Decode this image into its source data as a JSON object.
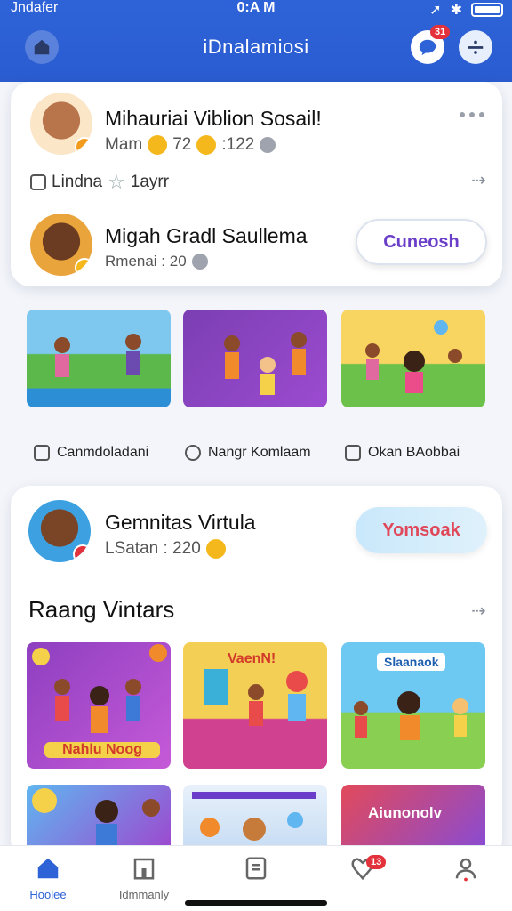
{
  "status": {
    "carrier": "Jndafer",
    "time": "0:A M"
  },
  "header": {
    "title": "iDnalamiosi",
    "chat_badge": "31"
  },
  "profile1": {
    "name": "Mihauriai Viblion Sosail!",
    "stats_label": "Mam",
    "stat1": "72",
    "stat2": ":122",
    "tag": "Lindna",
    "rating": "1ayrr"
  },
  "profile2": {
    "name": "Migah Gradl Saullema",
    "sub": "Rmenai : 20",
    "button": "Cuneosh"
  },
  "row1": [
    {
      "caption": "Canmdoladani"
    },
    {
      "caption": "Nangr Komlaam"
    },
    {
      "caption": "Okan BAobbai"
    }
  ],
  "profile3": {
    "name": "Gemnitas Virtula",
    "sub": "LSatan : 220",
    "button": "Yomsoak"
  },
  "section": {
    "title": "Raang Vintars"
  },
  "row2": [
    {
      "banner": "Nahlu Noog"
    },
    {
      "banner": "VaenN!"
    },
    {
      "banner": "Slaanaok"
    }
  ],
  "row3": [
    {
      "banner": ""
    },
    {
      "banner": ""
    },
    {
      "banner": "Aiunonolv"
    }
  ],
  "nav": [
    {
      "label": "Hoolee"
    },
    {
      "label": "Idmmanly"
    },
    {
      "label": ""
    },
    {
      "label": "",
      "badge": "13"
    },
    {
      "label": ""
    }
  ],
  "colors": {
    "header": "#2e63d8",
    "accent_purple": "#6a3ec8",
    "accent_red": "#e0485a",
    "badge": "#e3323b"
  }
}
